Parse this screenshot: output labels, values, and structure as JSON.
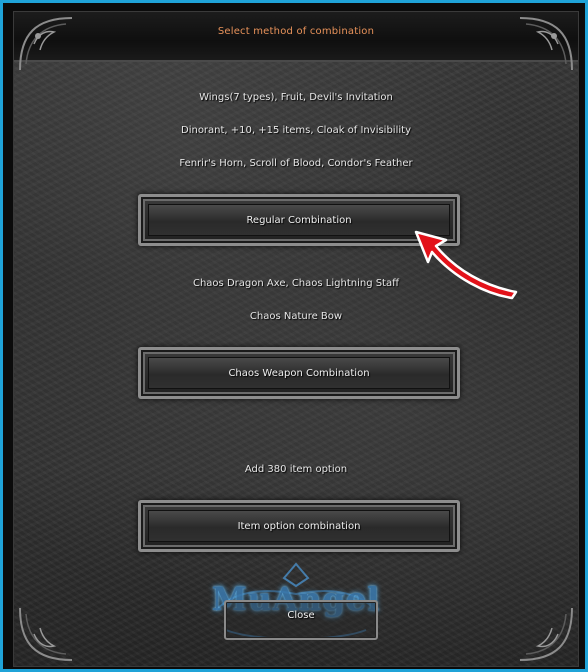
{
  "window": {
    "title": "Select method of combination"
  },
  "sections": [
    {
      "lines": [
        "Wings(7 types), Fruit, Devil's Invitation",
        "Dinorant, +10, +15 items, Cloak of Invisibility",
        "Fenrir's Horn, Scroll of Blood, Condor's Feather"
      ],
      "button_label": "Regular Combination"
    },
    {
      "lines": [
        "Chaos Dragon Axe, Chaos Lightning Staff",
        "Chaos Nature Bow"
      ],
      "button_label": "Chaos Weapon Combination"
    },
    {
      "lines": [
        "Add 380 item option"
      ],
      "button_label": "Item option combination"
    }
  ],
  "logo": {
    "text": "MuAngel"
  },
  "close_button": {
    "label": "Close"
  },
  "colors": {
    "frame_border": "#1fa3d8",
    "title_text": "#e8925a",
    "annotation_arrow": "#e3121a",
    "logo_glow": "#4fb6ff"
  },
  "icons": {
    "annotation": "red-curved-arrow-icon",
    "corners": "ornamental-corner-icon"
  }
}
